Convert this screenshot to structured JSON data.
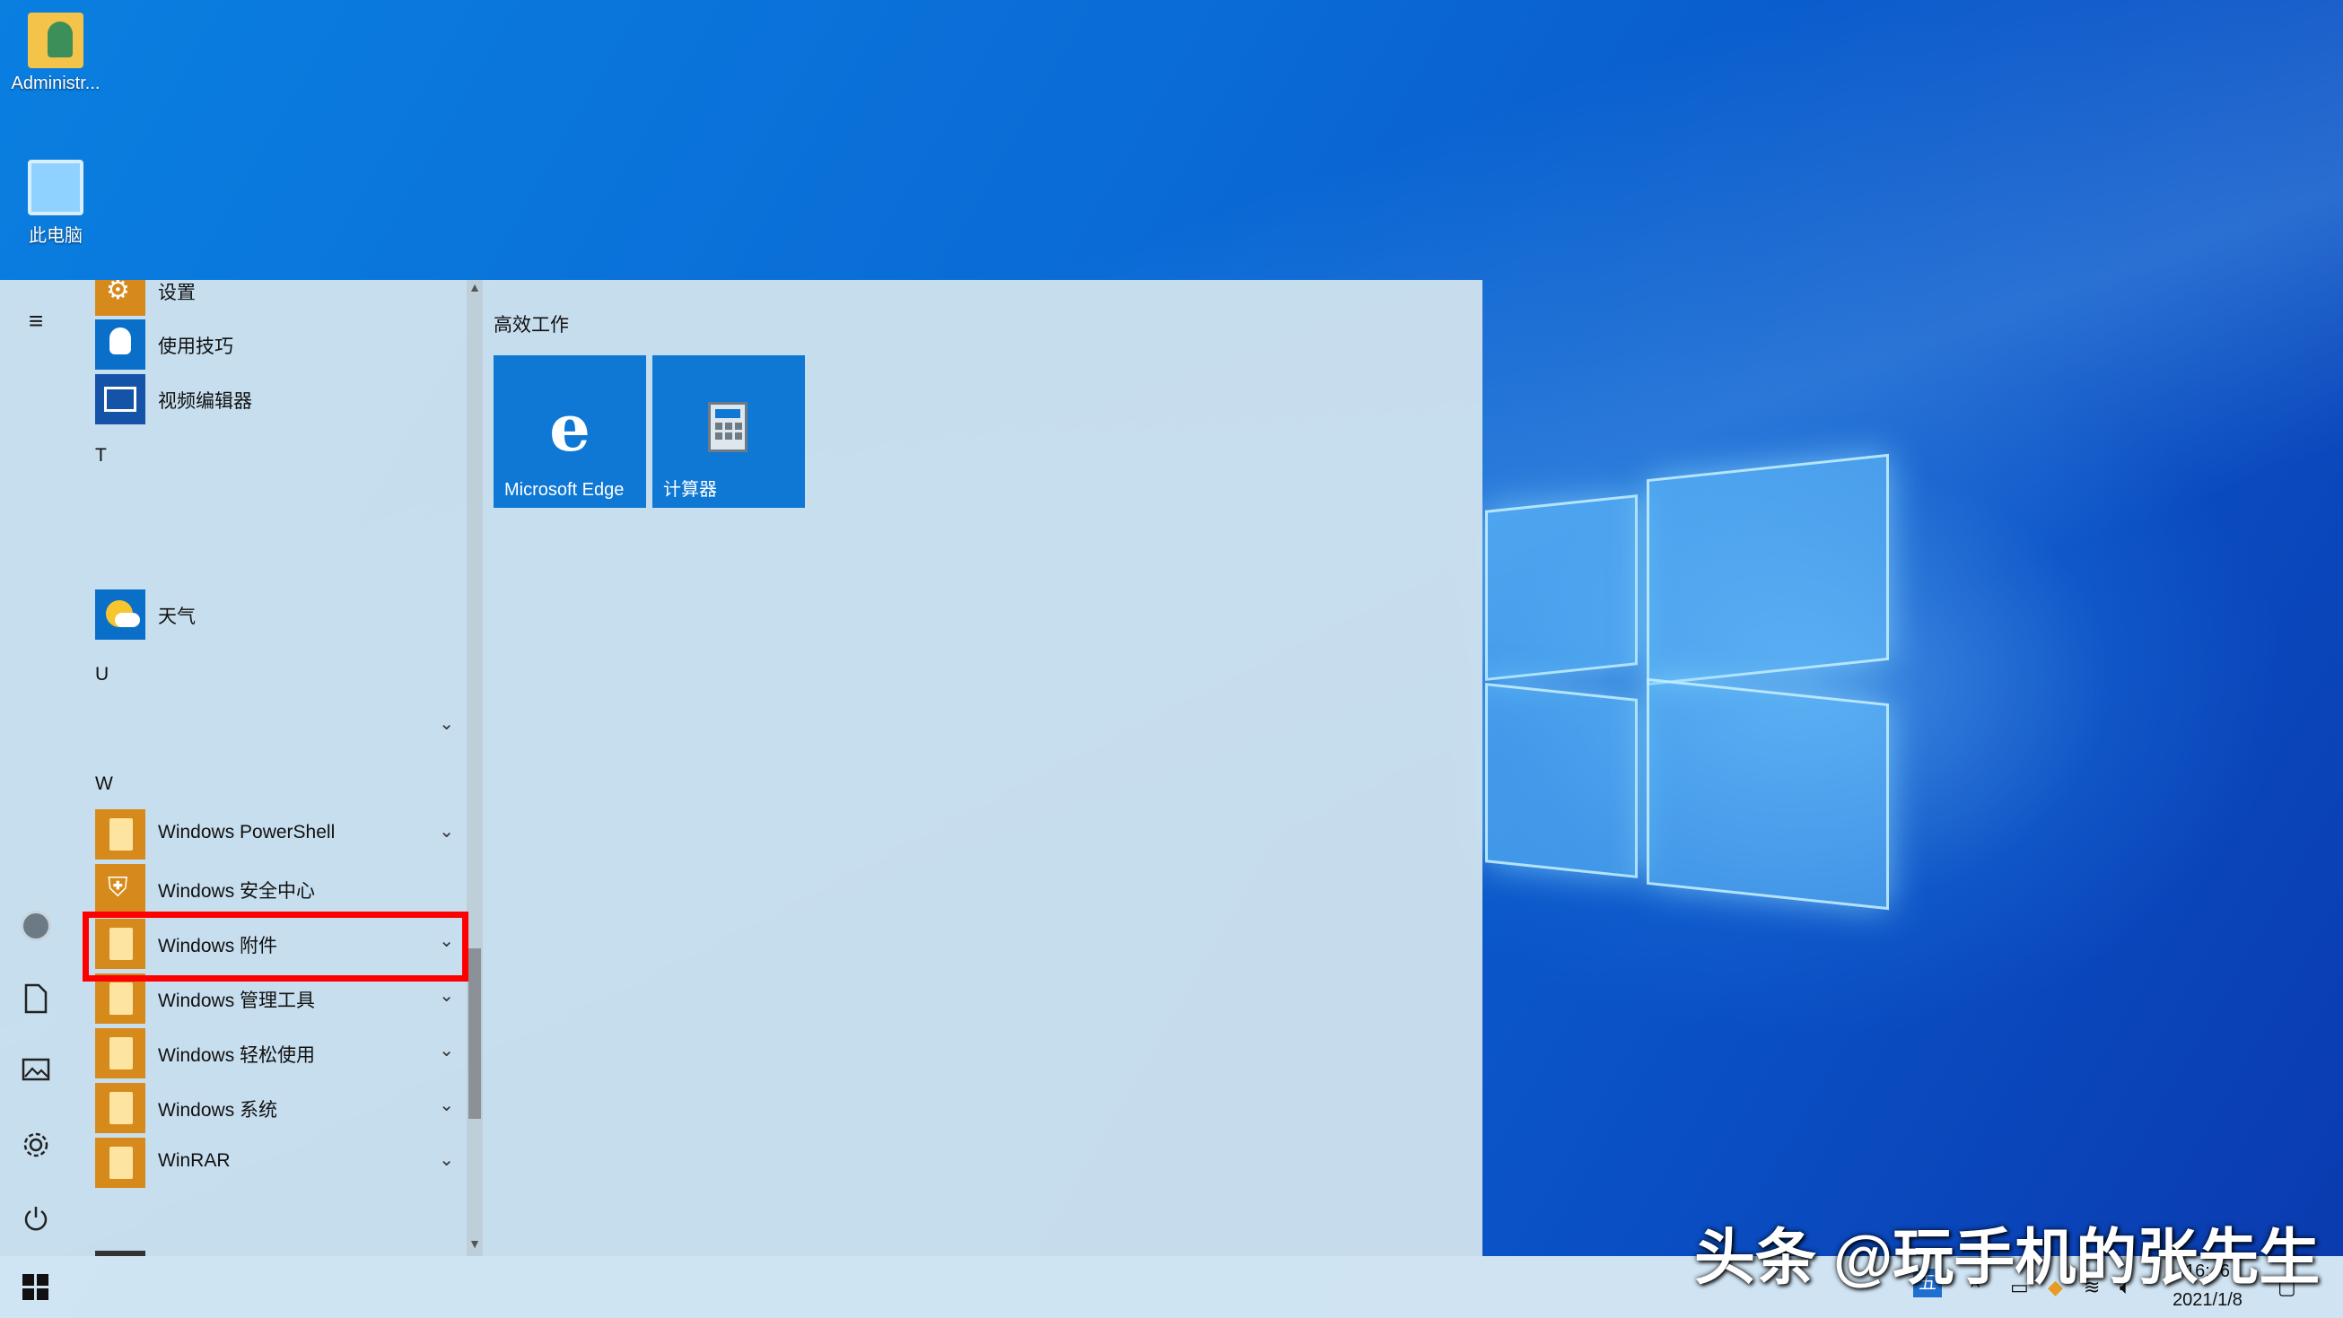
{
  "desktop": {
    "icons": [
      {
        "label": "Administr..."
      },
      {
        "label": "此电脑"
      }
    ]
  },
  "start_menu": {
    "apps": [
      {
        "label": "设置"
      },
      {
        "label": "使用技巧"
      },
      {
        "label": "视频编辑器"
      }
    ],
    "letters": {
      "t": "T",
      "u": "U",
      "w": "W"
    },
    "weather": {
      "label": "天气"
    },
    "w_apps": [
      {
        "label": "Windows PowerShell"
      },
      {
        "label": "Windows 安全中心"
      },
      {
        "label": "Windows 附件"
      },
      {
        "label": "Windows 管理工具"
      },
      {
        "label": "Windows 轻松使用"
      },
      {
        "label": "Windows 系统"
      },
      {
        "label": "WinRAR"
      }
    ],
    "group_title": "高效工作",
    "tiles": [
      {
        "label": "Microsoft Edge",
        "glyph": "e"
      },
      {
        "label": "计算器"
      }
    ]
  },
  "taskbar": {
    "ime": "五",
    "time": "16:46",
    "date": "2021/1/8"
  },
  "watermark": "头条 @玩手机的张先生",
  "colors": {
    "highlight": "#ff0000",
    "tile_blue": "#0f78d4",
    "folder_orange": "#d78a1c"
  }
}
